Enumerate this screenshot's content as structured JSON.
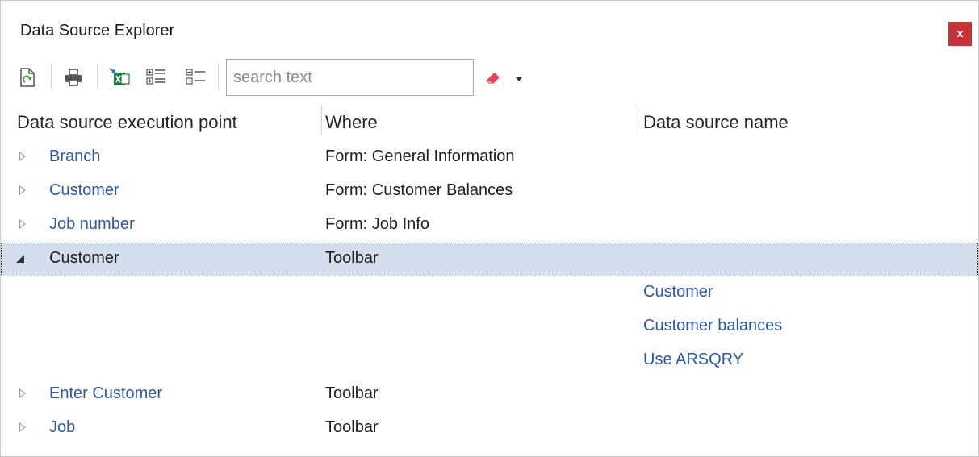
{
  "window": {
    "title": "Data Source Explorer",
    "close_label": "x"
  },
  "toolbar": {
    "items": [
      "refresh-icon",
      "print-icon",
      "export-excel-icon",
      "expand-all-icon",
      "collapse-all-icon"
    ],
    "search_placeholder": "search text",
    "search_value": "",
    "clear_icon": "eraser-icon",
    "dropdown_icon": "chevron-down-icon"
  },
  "columns": [
    "Data source execution point",
    "Where",
    "Data source name"
  ],
  "rows": [
    {
      "point": "Branch",
      "where": "Form: General Information",
      "name": "",
      "state": "collapsed"
    },
    {
      "point": "Customer",
      "where": "Form: Customer Balances",
      "name": "",
      "state": "collapsed"
    },
    {
      "point": "Job number",
      "where": "Form: Job Info",
      "name": "",
      "state": "collapsed"
    },
    {
      "point": "Customer",
      "where": "Toolbar",
      "name": "",
      "state": "expanded",
      "selected": true
    },
    {
      "point": "",
      "where": "",
      "name": "Customer",
      "state": "child"
    },
    {
      "point": "",
      "where": "",
      "name": "Customer balances",
      "state": "child"
    },
    {
      "point": "",
      "where": "",
      "name": "Use ARSQRY",
      "state": "child"
    },
    {
      "point": "Enter Customer",
      "where": "Toolbar",
      "name": "",
      "state": "collapsed"
    },
    {
      "point": "Job",
      "where": "Toolbar",
      "name": "",
      "state": "collapsed"
    }
  ],
  "colors": {
    "link": "#2f57a6",
    "selected_row": "#d4deec",
    "close_button": "#c73236"
  }
}
